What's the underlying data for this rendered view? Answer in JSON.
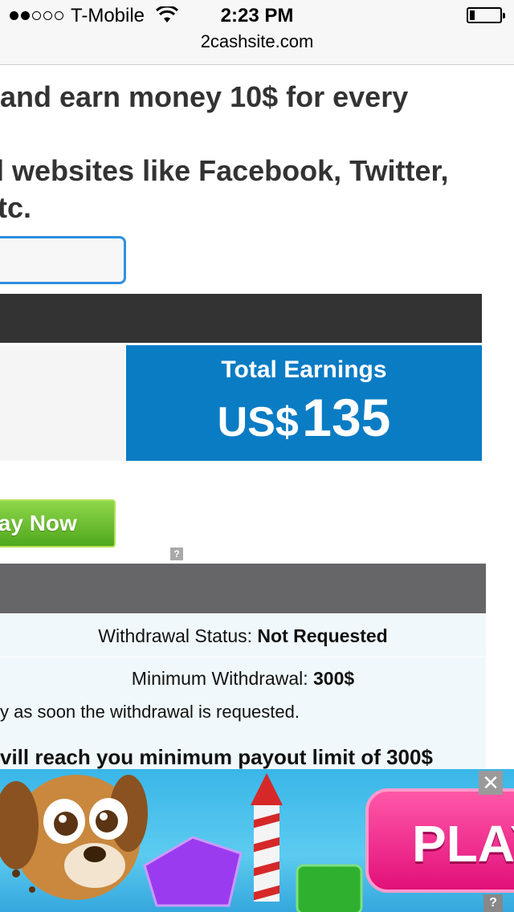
{
  "status_bar": {
    "carrier": "T-Mobile",
    "time": "2:23 PM",
    "url": "2cashsite.com",
    "signal_bars_filled": 2,
    "signal_bars_total": 5
  },
  "content": {
    "headline_line1": "and earn money 10$ for every",
    "headline_line2": "l websites like Facebook, Twitter,",
    "headline_line3": "tc.",
    "input_value": "",
    "earnings": {
      "title": "Total Earnings",
      "currency": "US$",
      "amount": "135"
    },
    "play_button_label": "lay Now",
    "ad_info_small": "?",
    "withdrawal_status_label": "Withdrawal Status: ",
    "withdrawal_status_value": "Not Requested",
    "minimum_withdrawal_label": "Minimum Withdrawal: ",
    "minimum_withdrawal_value": "300$",
    "payment_note": "y as soon the withdrawal is requested.",
    "payout_note": "vill reach you minimum payout limit of 300$"
  },
  "ad_banner": {
    "close_label": "✕",
    "info_label": "?",
    "play_label": "PLAY"
  },
  "colors": {
    "accent_blue": "#0a7cc4",
    "input_border": "#2f8fe0",
    "dark_bar": "#333333",
    "section_bar": "#666668",
    "play_green": "#5cb82a",
    "ad_pink": "#e2107a"
  }
}
